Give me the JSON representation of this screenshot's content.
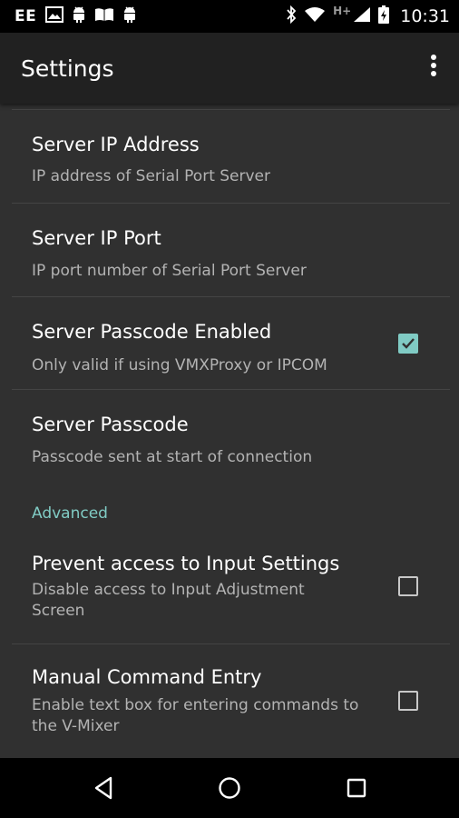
{
  "status_bar": {
    "carrier": "EE",
    "network_type": "H+",
    "time": "10:31",
    "icons": [
      "image-icon",
      "android-icon",
      "android-icon",
      "book-icon",
      "android-icon",
      "bluetooth-icon",
      "wifi-icon",
      "signal-icon",
      "battery-icon"
    ]
  },
  "app_bar": {
    "title": "Settings",
    "overflow_icon": "more-vert-icon"
  },
  "preferences": [
    {
      "title": "Server IP Address",
      "summary": "IP address of Serial Port Server"
    },
    {
      "title": "Server IP Port",
      "summary": "IP port number of Serial Port Server"
    },
    {
      "title": "Server Passcode Enabled",
      "summary": "Only valid if using VMXProxy or IPCOM",
      "checked": true
    },
    {
      "title": "Server Passcode",
      "summary": "Passcode sent at start of connection"
    }
  ],
  "advanced": {
    "header": "Advanced",
    "items": [
      {
        "title": "Prevent access to Input Settings",
        "summary_line1": "Disable access to Input Adjustment",
        "summary_line2": "Screen",
        "checked": false
      },
      {
        "title": "Manual Command Entry",
        "summary_line1": "Enable text box for entering commands to",
        "summary_line2": "the V-Mixer",
        "checked": false
      }
    ]
  },
  "nav_bar": {
    "buttons": [
      "back-icon",
      "home-icon",
      "recents-icon"
    ]
  },
  "colors": {
    "accent": "#80cbc4",
    "background": "#303030",
    "app_bar": "#212121",
    "status_bar": "#000000"
  }
}
